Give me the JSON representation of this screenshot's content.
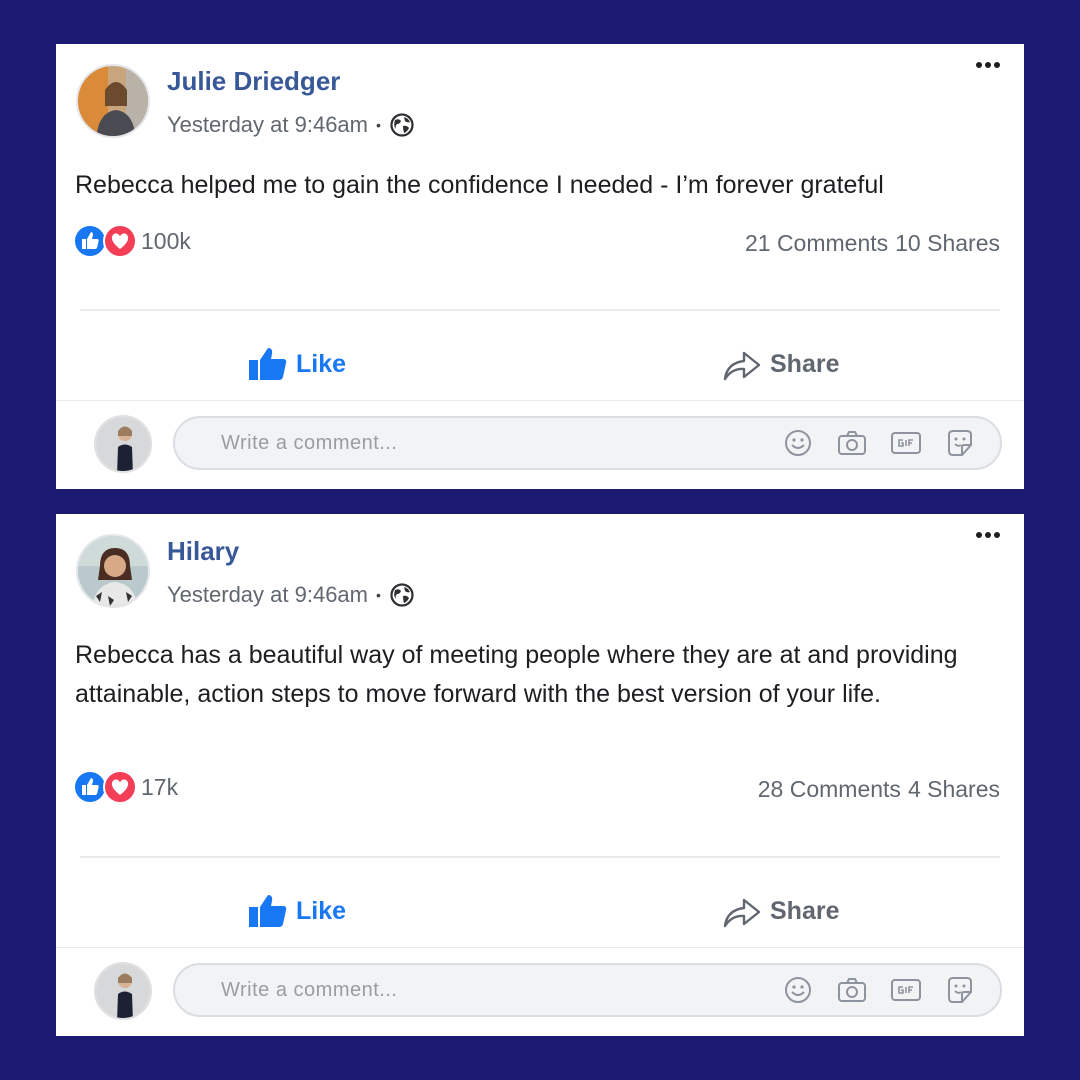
{
  "posts": [
    {
      "author": "Julie Driedger",
      "timestamp": "Yesterday at 9:46am",
      "separator": "•",
      "privacy_icon": "globe-icon",
      "text": "Rebecca helped me to gain the confidence I needed - I’m forever grateful",
      "reaction_count": "100k",
      "comments": "21 Comments",
      "shares": "10 Shares",
      "like_label": "Like",
      "share_label": "Share",
      "comment_placeholder": "Write a comment..."
    },
    {
      "author": "Hilary",
      "timestamp": "Yesterday at 9:46am",
      "separator": "•",
      "privacy_icon": "globe-icon",
      "text": "Rebecca has a beautiful way of meeting people where they are at and providing attainable, action steps to move forward with the best version of your life.",
      "reaction_count": "17k",
      "comments": "28 Comments",
      "shares": "4 Shares",
      "like_label": "Like",
      "share_label": "Share",
      "comment_placeholder": "Write a comment..."
    }
  ],
  "colors": {
    "background": "#1c1970",
    "author_link": "#385898",
    "like_blue": "#1877f2",
    "love_red": "#f33e58",
    "muted_text": "#606770"
  },
  "reaction_icons": [
    "like-reaction-icon",
    "love-reaction-icon"
  ],
  "comment_tools": [
    "emoji-icon",
    "camera-icon",
    "gif-icon",
    "sticker-icon"
  ]
}
